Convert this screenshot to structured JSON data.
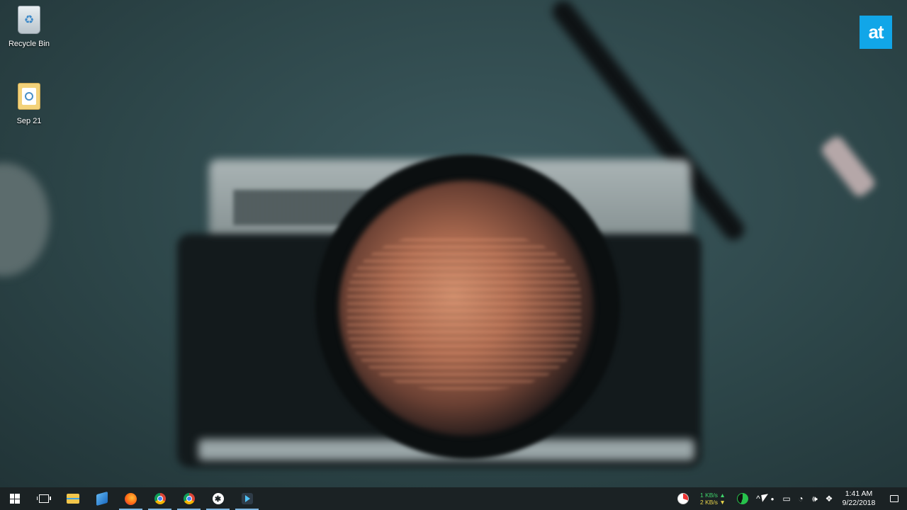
{
  "desktop": {
    "icons": [
      {
        "label": "Recycle Bin",
        "icon": "recycle-bin-icon"
      },
      {
        "label": "Sep 21",
        "icon": "folder-icon"
      }
    ],
    "watermark": "at"
  },
  "taskbar": {
    "apps": [
      {
        "name": "start",
        "icon": "windows-logo-icon"
      },
      {
        "name": "task-view",
        "icon": "task-view-icon"
      },
      {
        "name": "file-explorer",
        "icon": "folder-icon"
      },
      {
        "name": "paint",
        "icon": "paint-icon"
      },
      {
        "name": "firefox",
        "icon": "firefox-icon"
      },
      {
        "name": "chrome-profile",
        "icon": "chrome-icon"
      },
      {
        "name": "chrome",
        "icon": "chrome-icon"
      },
      {
        "name": "slack",
        "icon": "slack-icon"
      },
      {
        "name": "app",
        "icon": "app-icon"
      }
    ],
    "tray": {
      "net_up": "1 KB/s ▲",
      "net_down": "2 KB/s ▼",
      "time": "1:41 AM",
      "date": "9/22/2018",
      "overflow_glyph": "^",
      "volume_glyph": "🕪",
      "wifi_glyph": "◔",
      "dropbox_glyph": "❖",
      "battery_glyph": "▭",
      "drop_glyph": "●"
    },
    "colors": {
      "bg": "#1b2224",
      "accent": "#7fb6e0"
    }
  }
}
